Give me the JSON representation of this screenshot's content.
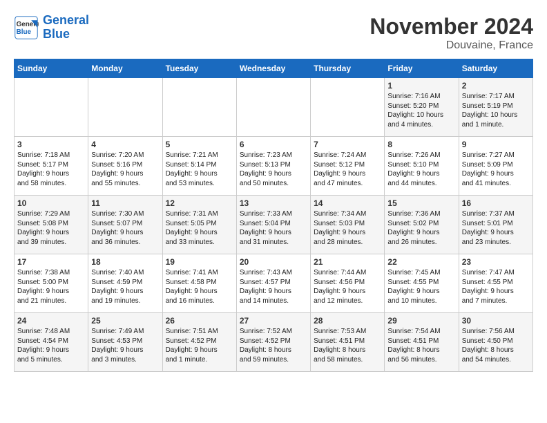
{
  "header": {
    "logo_line1": "General",
    "logo_line2": "Blue",
    "month": "November 2024",
    "location": "Douvaine, France"
  },
  "weekdays": [
    "Sunday",
    "Monday",
    "Tuesday",
    "Wednesday",
    "Thursday",
    "Friday",
    "Saturday"
  ],
  "weeks": [
    [
      {
        "day": "",
        "info": ""
      },
      {
        "day": "",
        "info": ""
      },
      {
        "day": "",
        "info": ""
      },
      {
        "day": "",
        "info": ""
      },
      {
        "day": "",
        "info": ""
      },
      {
        "day": "1",
        "info": "Sunrise: 7:16 AM\nSunset: 5:20 PM\nDaylight: 10 hours\nand 4 minutes."
      },
      {
        "day": "2",
        "info": "Sunrise: 7:17 AM\nSunset: 5:19 PM\nDaylight: 10 hours\nand 1 minute."
      }
    ],
    [
      {
        "day": "3",
        "info": "Sunrise: 7:18 AM\nSunset: 5:17 PM\nDaylight: 9 hours\nand 58 minutes."
      },
      {
        "day": "4",
        "info": "Sunrise: 7:20 AM\nSunset: 5:16 PM\nDaylight: 9 hours\nand 55 minutes."
      },
      {
        "day": "5",
        "info": "Sunrise: 7:21 AM\nSunset: 5:14 PM\nDaylight: 9 hours\nand 53 minutes."
      },
      {
        "day": "6",
        "info": "Sunrise: 7:23 AM\nSunset: 5:13 PM\nDaylight: 9 hours\nand 50 minutes."
      },
      {
        "day": "7",
        "info": "Sunrise: 7:24 AM\nSunset: 5:12 PM\nDaylight: 9 hours\nand 47 minutes."
      },
      {
        "day": "8",
        "info": "Sunrise: 7:26 AM\nSunset: 5:10 PM\nDaylight: 9 hours\nand 44 minutes."
      },
      {
        "day": "9",
        "info": "Sunrise: 7:27 AM\nSunset: 5:09 PM\nDaylight: 9 hours\nand 41 minutes."
      }
    ],
    [
      {
        "day": "10",
        "info": "Sunrise: 7:29 AM\nSunset: 5:08 PM\nDaylight: 9 hours\nand 39 minutes."
      },
      {
        "day": "11",
        "info": "Sunrise: 7:30 AM\nSunset: 5:07 PM\nDaylight: 9 hours\nand 36 minutes."
      },
      {
        "day": "12",
        "info": "Sunrise: 7:31 AM\nSunset: 5:05 PM\nDaylight: 9 hours\nand 33 minutes."
      },
      {
        "day": "13",
        "info": "Sunrise: 7:33 AM\nSunset: 5:04 PM\nDaylight: 9 hours\nand 31 minutes."
      },
      {
        "day": "14",
        "info": "Sunrise: 7:34 AM\nSunset: 5:03 PM\nDaylight: 9 hours\nand 28 minutes."
      },
      {
        "day": "15",
        "info": "Sunrise: 7:36 AM\nSunset: 5:02 PM\nDaylight: 9 hours\nand 26 minutes."
      },
      {
        "day": "16",
        "info": "Sunrise: 7:37 AM\nSunset: 5:01 PM\nDaylight: 9 hours\nand 23 minutes."
      }
    ],
    [
      {
        "day": "17",
        "info": "Sunrise: 7:38 AM\nSunset: 5:00 PM\nDaylight: 9 hours\nand 21 minutes."
      },
      {
        "day": "18",
        "info": "Sunrise: 7:40 AM\nSunset: 4:59 PM\nDaylight: 9 hours\nand 19 minutes."
      },
      {
        "day": "19",
        "info": "Sunrise: 7:41 AM\nSunset: 4:58 PM\nDaylight: 9 hours\nand 16 minutes."
      },
      {
        "day": "20",
        "info": "Sunrise: 7:43 AM\nSunset: 4:57 PM\nDaylight: 9 hours\nand 14 minutes."
      },
      {
        "day": "21",
        "info": "Sunrise: 7:44 AM\nSunset: 4:56 PM\nDaylight: 9 hours\nand 12 minutes."
      },
      {
        "day": "22",
        "info": "Sunrise: 7:45 AM\nSunset: 4:55 PM\nDaylight: 9 hours\nand 10 minutes."
      },
      {
        "day": "23",
        "info": "Sunrise: 7:47 AM\nSunset: 4:55 PM\nDaylight: 9 hours\nand 7 minutes."
      }
    ],
    [
      {
        "day": "24",
        "info": "Sunrise: 7:48 AM\nSunset: 4:54 PM\nDaylight: 9 hours\nand 5 minutes."
      },
      {
        "day": "25",
        "info": "Sunrise: 7:49 AM\nSunset: 4:53 PM\nDaylight: 9 hours\nand 3 minutes."
      },
      {
        "day": "26",
        "info": "Sunrise: 7:51 AM\nSunset: 4:52 PM\nDaylight: 9 hours\nand 1 minute."
      },
      {
        "day": "27",
        "info": "Sunrise: 7:52 AM\nSunset: 4:52 PM\nDaylight: 8 hours\nand 59 minutes."
      },
      {
        "day": "28",
        "info": "Sunrise: 7:53 AM\nSunset: 4:51 PM\nDaylight: 8 hours\nand 58 minutes."
      },
      {
        "day": "29",
        "info": "Sunrise: 7:54 AM\nSunset: 4:51 PM\nDaylight: 8 hours\nand 56 minutes."
      },
      {
        "day": "30",
        "info": "Sunrise: 7:56 AM\nSunset: 4:50 PM\nDaylight: 8 hours\nand 54 minutes."
      }
    ]
  ]
}
